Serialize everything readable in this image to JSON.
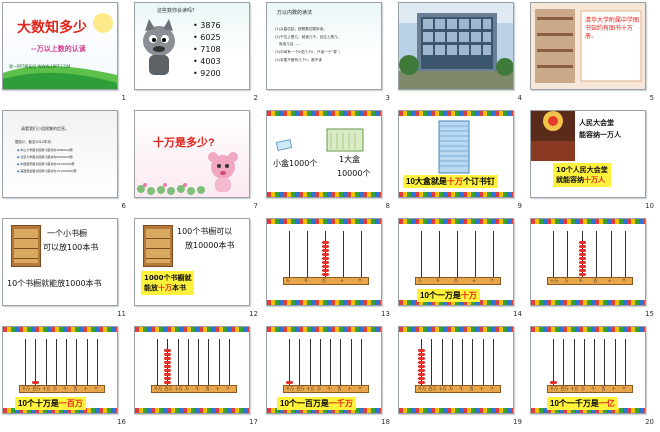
{
  "slides": [
    {
      "num": "1",
      "title": "大数知多少",
      "subtitle": "--万以上数的认读",
      "site": "第一PPT模板网 WWW.1PPT.COM"
    },
    {
      "num": "2",
      "question": "这些数你会读吗？",
      "numbers": [
        "3876",
        "6025",
        "7108",
        "4003",
        "9200"
      ]
    },
    {
      "num": "3",
      "heading": "万以内数的读法",
      "lines": [
        "(1)从高位起，按照数位顺序读。",
        "(2)千位上是几，就读几千，百位上是几，",
        "就读几百……",
        "(3)中间有一个0或几个0，只读一个“零”；",
        "(4)末尾不管有几个0，都不读"
      ]
    },
    {
      "num": "4"
    },
    {
      "num": "5",
      "text": "清华大学附属中学图书馆约有图书十万册。"
    },
    {
      "num": "6",
      "intro": "请看我们小组搜集的信息。",
      "note": "据统计，截至2012年末：",
      "items": [
        "中山大学图书馆累计藏书约4086000册",
        "北京大学图书馆累计藏书约8000000册",
        "中国国家图书馆累计藏书约29100000册",
        "美国国会图书馆累计藏书约151000000册"
      ]
    },
    {
      "num": "7",
      "title": "十万是多少?"
    },
    {
      "num": "8",
      "small": "小盒1000个",
      "big_a": "1大盒",
      "big_b": "10000个"
    },
    {
      "num": "9",
      "caption_a": "10大盒就是",
      "caption_red": "十万",
      "caption_b": "个订书钉"
    },
    {
      "num": "10",
      "top_a": "人民大会堂",
      "top_b": "能容纳一万人",
      "bot_a": "10个人民大会堂",
      "bot_b_a": "就能容纳",
      "bot_red": "十万人"
    },
    {
      "num": "11",
      "line1": "一个小书橱",
      "line2": "可以放100本书",
      "line3": "10个书橱就能放1000本书"
    },
    {
      "num": "12",
      "line1": "100个书橱可以",
      "line2": "放10000本书",
      "line3": "1000个书橱就",
      "line4_a": "能放",
      "line4_red": "十万",
      "line4_b": "本书"
    },
    {
      "num": "13",
      "labels": [
        "万",
        "千",
        "百",
        "十",
        "个"
      ]
    },
    {
      "num": "14",
      "labels": [
        "万",
        "千",
        "百",
        "十",
        "个"
      ],
      "caption_a": "10个一万是",
      "caption_red": "十万"
    },
    {
      "num": "15",
      "labels": [
        "十万",
        "万",
        "千",
        "百",
        "十",
        "个"
      ]
    },
    {
      "num": "16",
      "labels": [
        "千万",
        "百万",
        "十万",
        "万",
        "千",
        "百",
        "十",
        "个"
      ],
      "caption_a": "10个十万是",
      "caption_red": "一百万"
    },
    {
      "num": "17",
      "labels": [
        "千万",
        "百万",
        "十万",
        "万",
        "千",
        "百",
        "十",
        "个"
      ]
    },
    {
      "num": "18",
      "labels": [
        "千万",
        "百万",
        "十万",
        "万",
        "千",
        "百",
        "十",
        "个"
      ],
      "caption_a": "10个一百万是",
      "caption_red": "一千万"
    },
    {
      "num": "19",
      "labels": [
        "千万",
        "百万",
        "十万",
        "万",
        "千",
        "百",
        "十",
        "个"
      ]
    },
    {
      "num": "20",
      "labels": [
        "千万",
        "百万",
        "十万",
        "万",
        "千",
        "百",
        "十",
        "个"
      ],
      "caption_a": "10个一千万是",
      "caption_red": "一亿"
    }
  ]
}
